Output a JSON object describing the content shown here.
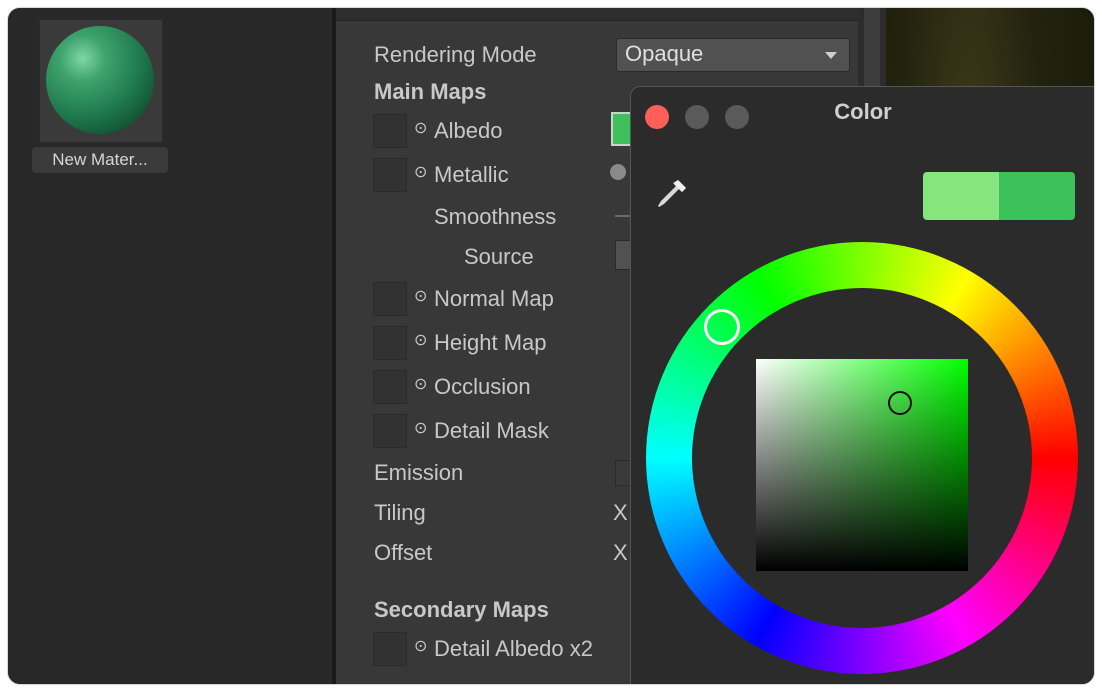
{
  "project": {
    "asset_label": "New Mater..."
  },
  "inspector": {
    "rendering_mode_label": "Rendering Mode",
    "rendering_mode_value": "Opaque",
    "main_maps_title": "Main Maps",
    "albedo": "Albedo",
    "metallic": "Metallic",
    "smoothness": "Smoothness",
    "source": "Source",
    "normal_map": "Normal Map",
    "height_map": "Height Map",
    "occlusion": "Occlusion",
    "detail_mask": "Detail Mask",
    "emission": "Emission",
    "tiling": "Tiling",
    "offset": "Offset",
    "tiling_x": "X",
    "offset_x": "X",
    "secondary_maps_title": "Secondary Maps",
    "detail_albedo": "Detail Albedo x2",
    "target_icon": "⊙"
  },
  "color_window": {
    "title": "Color",
    "icons": [
      "close-icon",
      "minimize-icon",
      "zoom-icon",
      "eyedropper-icon"
    ],
    "colors": {
      "close": "#ff5f57",
      "minimize": "#5a5a5a",
      "zoom": "#5a5a5a",
      "previous_color": "#86e57c",
      "current_color": "#3cc25a"
    }
  }
}
